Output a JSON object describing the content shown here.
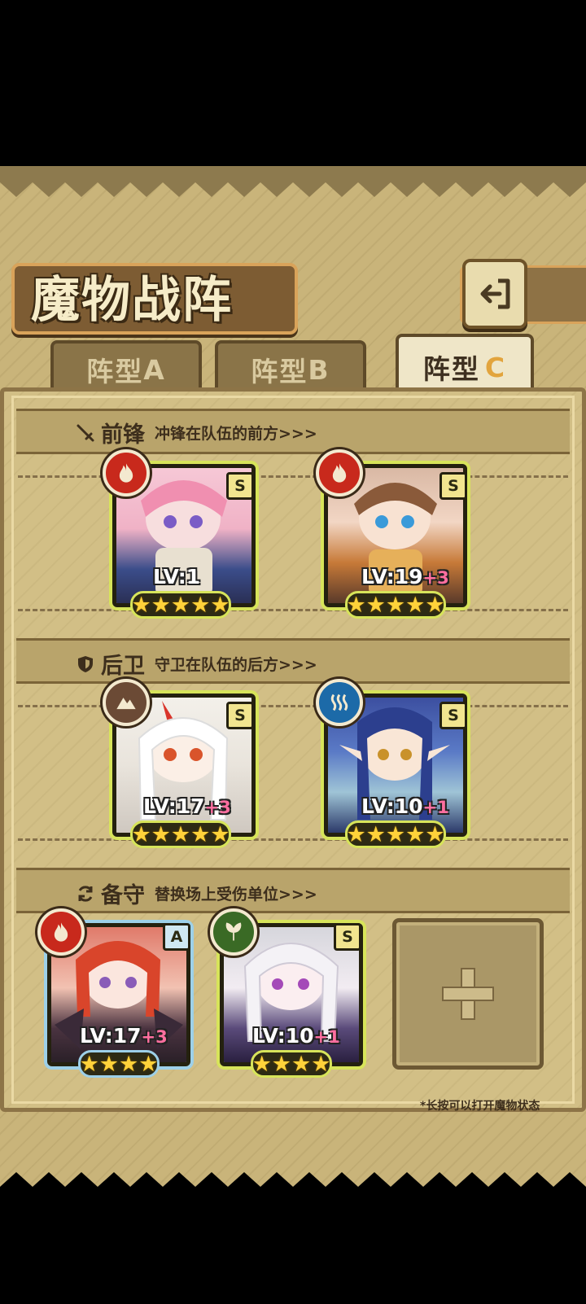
{
  "header": {
    "title": "魔物战阵",
    "back_icon": "back-arrow-icon"
  },
  "tabs": [
    {
      "label": "阵型",
      "letter": "A",
      "active": false
    },
    {
      "label": "阵型",
      "letter": "B",
      "active": false
    },
    {
      "label": "阵型",
      "letter": "C",
      "active": true
    }
  ],
  "sections": {
    "vanguard": {
      "title": "前锋",
      "desc": "冲锋在队伍的前方>>>"
    },
    "rearguard": {
      "title": "后卫",
      "desc": "守卫在队伍的后方>>>"
    },
    "reserve": {
      "title": "备守",
      "desc": "替换场上受伤单位>>>"
    }
  },
  "units": {
    "v1": {
      "grade": "S",
      "element": "fire",
      "lv": "LV:1",
      "plus": "",
      "stars": 5
    },
    "v2": {
      "grade": "S",
      "element": "fire",
      "lv": "LV:19",
      "plus": "+3",
      "stars": 5
    },
    "r1": {
      "grade": "S",
      "element": "earth",
      "lv": "LV:17",
      "plus": "+3",
      "stars": 5
    },
    "r2": {
      "grade": "S",
      "element": "water",
      "lv": "LV:10",
      "plus": "+1",
      "stars": 5
    },
    "b1": {
      "grade": "A",
      "element": "fire",
      "lv": "LV:17",
      "plus": "+3",
      "stars": 4
    },
    "b2": {
      "grade": "S",
      "element": "wind",
      "lv": "LV:10",
      "plus": "+1",
      "stars": 4
    }
  },
  "colors": {
    "fire": "#c8291c",
    "earth": "#6b4a35",
    "water": "#1c6aa8",
    "wind": "#3a6a25",
    "frame": "#d7e45a",
    "frame_a": "#9dd0e8"
  },
  "footer": {
    "hint": "*长按可以打开魔物状态"
  }
}
